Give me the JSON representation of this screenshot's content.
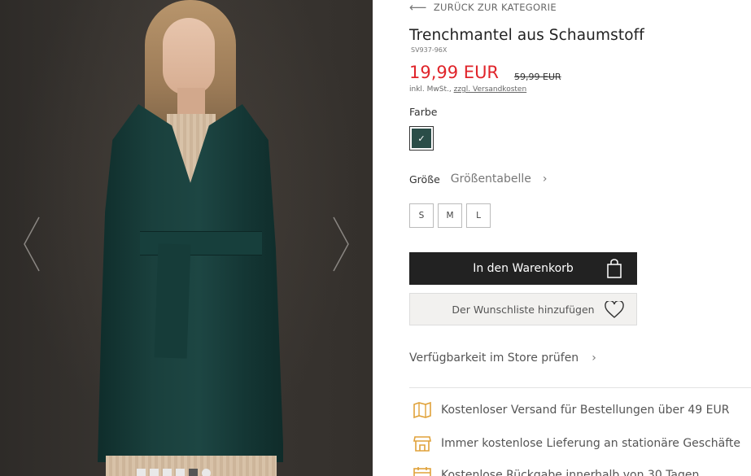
{
  "gallery": {
    "prev_icon": "chevron-left-icon",
    "next_icon": "chevron-right-icon",
    "dots": [
      {
        "active": false,
        "shape": "square"
      },
      {
        "active": false,
        "shape": "square"
      },
      {
        "active": false,
        "shape": "square"
      },
      {
        "active": false,
        "shape": "square"
      },
      {
        "active": true,
        "shape": "square"
      },
      {
        "active": false,
        "shape": "round"
      }
    ]
  },
  "product": {
    "back_label": "ZURÜCK ZUR KATEGORIE",
    "title": "Trenchmantel aus Schaumstoff",
    "sku": "SV937-96X",
    "price": "19,99 EUR",
    "old_price": "59,99 EUR",
    "tax_text": "inkl. MwSt.,",
    "shipping_link": "zzgl. Versandkosten",
    "color_label": "Farbe",
    "selected_color": "#2a4d48",
    "size_label": "Größe",
    "size_chart_label": "Größentabelle",
    "sizes": [
      "S",
      "M",
      "L"
    ],
    "add_to_cart": "In den Warenkorb",
    "add_to_wishlist": "Der Wunschliste hinzufügen",
    "store_availability": "Verfügbarkeit im Store prüfen",
    "price_color": "#e0242a",
    "icon_color": "#e0a23a"
  },
  "benefits": [
    {
      "text": "Kostenloser Versand für Bestellungen über 49 EUR",
      "icon": "map-icon"
    },
    {
      "text": "Immer kostenlose Lieferung an stationäre Geschäfte",
      "icon": "store-icon"
    },
    {
      "text": "Kostenlose Rückgabe innerhalb von 30 Tagen",
      "icon": "calendar-icon"
    }
  ]
}
